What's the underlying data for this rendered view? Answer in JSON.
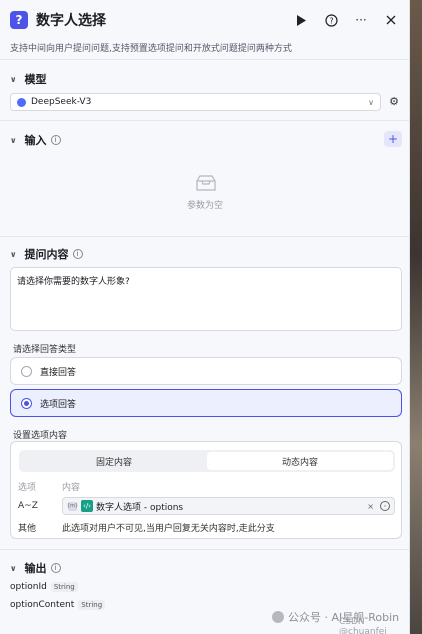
{
  "header": {
    "title": "数字人选择",
    "subtitle": "支持中间向用户提问问题,支持预置选项提问和开放式问题提问两种方式"
  },
  "model": {
    "section_title": "模型",
    "selected": "DeepSeek-V3"
  },
  "input": {
    "section_title": "输入",
    "empty_text": "参数为空"
  },
  "question": {
    "section_title": "提问内容",
    "content": "请选择你需要的数字人形象?",
    "answer_type_label": "请选择回答类型",
    "options": [
      {
        "label": "直接回答",
        "selected": false
      },
      {
        "label": "选项回答",
        "selected": true
      }
    ],
    "settings_label": "设置选项内容",
    "tabs": [
      "固定内容",
      "动态内容"
    ],
    "active_tab": "动态内容",
    "col_option": "选项",
    "col_content": "内容",
    "row1_key": "A~Z",
    "row1_tag": "{m}",
    "row1_value": "数字人选项 - options",
    "row2_key": "其他",
    "row2_value": "此选项对用户不可见,当用户回复无关内容时,走此分支"
  },
  "output": {
    "section_title": "输出",
    "fields": [
      {
        "name": "optionId",
        "type": "String"
      },
      {
        "name": "optionContent",
        "type": "String"
      }
    ]
  },
  "watermark": {
    "text": "公众号 · AI星舰-Robin",
    "csdn": "CSDN @chuanfei"
  },
  "colors": {
    "accent": "#4d53e8",
    "code_icon": "#16a085"
  }
}
